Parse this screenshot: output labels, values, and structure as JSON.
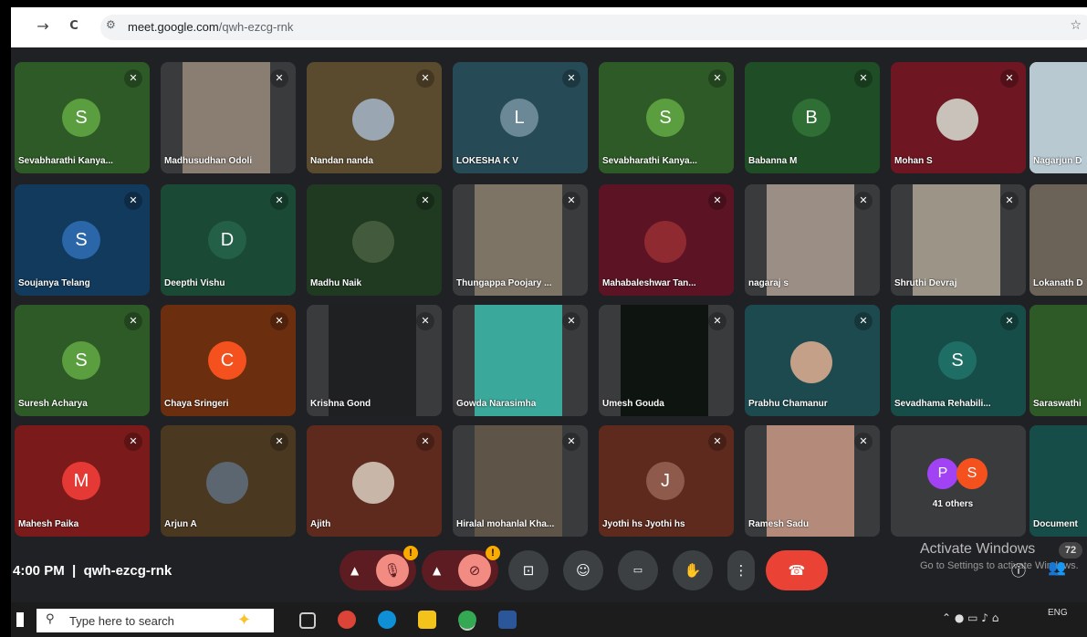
{
  "browser": {
    "back": "←",
    "forward": "→",
    "reload": "C",
    "url_domain": "meet.google.com",
    "url_path": "/qwh-ezcg-rnk"
  },
  "tiles": [
    {
      "name": "Sevabharathi Kanya...",
      "bg": "#2d5a27",
      "kind": "initial",
      "initial": "S",
      "acolor": "#5b9e3f"
    },
    {
      "name": "Madhusudhan Odoli",
      "bg": "#3a3b3d",
      "kind": "video",
      "vcolor": "#8a7d72"
    },
    {
      "name": "Nandan nanda",
      "bg": "#5a4a2e",
      "kind": "photo",
      "pcolor": "#9aa7b3"
    },
    {
      "name": "LOKESHA K V",
      "bg": "#274a57",
      "kind": "initial",
      "initial": "L",
      "acolor": "#6b8896"
    },
    {
      "name": "Sevabharathi Kanya...",
      "bg": "#2d5a27",
      "kind": "initial",
      "initial": "S",
      "acolor": "#5b9e3f"
    },
    {
      "name": "Babanna M",
      "bg": "#1f4d26",
      "kind": "initial",
      "initial": "B",
      "acolor": "#2f6e35"
    },
    {
      "name": "Mohan S",
      "bg": "#6e1622",
      "kind": "photo",
      "pcolor": "#c9c2bb"
    },
    {
      "name": "Nagarjun D",
      "bg": "#8aa6b8",
      "kind": "video",
      "vcolor": "#b8c9d2"
    },
    {
      "name": "Soujanya Telang",
      "bg": "#123a5c",
      "kind": "initial",
      "initial": "S",
      "acolor": "#2a66a8"
    },
    {
      "name": "Deepthi Vishu",
      "bg": "#1a4a36",
      "kind": "initial",
      "initial": "D",
      "acolor": "#236047"
    },
    {
      "name": "Madhu Naik",
      "bg": "#1f3a20",
      "kind": "photo",
      "pcolor": "#445a3c"
    },
    {
      "name": "Thungappa Poojary ...",
      "bg": "#3a3b3d",
      "kind": "video",
      "vcolor": "#7d7466"
    },
    {
      "name": "Mahabaleshwar Tan...",
      "bg": "#5c1424",
      "kind": "photo",
      "pcolor": "#8e2a30"
    },
    {
      "name": "nagaraj s",
      "bg": "#3a3b3d",
      "kind": "video",
      "vcolor": "#9b8e85"
    },
    {
      "name": "Shruthi Devraj",
      "bg": "#3a3b3d",
      "kind": "video",
      "vcolor": "#9b9487"
    },
    {
      "name": "Lokanath D",
      "bg": "#3a3b3d",
      "kind": "video",
      "vcolor": "#6b6358"
    },
    {
      "name": "Suresh Acharya",
      "bg": "#2d5a27",
      "kind": "initial",
      "initial": "S",
      "acolor": "#5b9e3f"
    },
    {
      "name": "Chaya Sringeri",
      "bg": "#6b2e0f",
      "kind": "initial",
      "initial": "C",
      "acolor": "#f4511e"
    },
    {
      "name": "Krishna Gond",
      "bg": "#3a3b3d",
      "kind": "video",
      "vcolor": "#1f2022"
    },
    {
      "name": "Gowda Narasimha",
      "bg": "#3a3b3d",
      "kind": "video",
      "vcolor": "#3aa89a"
    },
    {
      "name": "Umesh Gouda",
      "bg": "#3a3b3d",
      "kind": "video",
      "vcolor": "#0e1510"
    },
    {
      "name": "Prabhu Chamanur",
      "bg": "#1c4a4f",
      "kind": "photo",
      "pcolor": "#c4a088"
    },
    {
      "name": "Sevadhama Rehabili...",
      "bg": "#174d48",
      "kind": "initial",
      "initial": "S",
      "acolor": "#1e6e66"
    },
    {
      "name": "Saraswathi",
      "bg": "#2d5a27",
      "kind": "video",
      "vcolor": "#2d5a27"
    },
    {
      "name": "Mahesh Paika",
      "bg": "#7a1a1a",
      "kind": "initial",
      "initial": "M",
      "acolor": "#e53935"
    },
    {
      "name": "Arjun A",
      "bg": "#4a3820",
      "kind": "photo",
      "pcolor": "#5c6670"
    },
    {
      "name": "Ajith",
      "bg": "#5e2a1e",
      "kind": "photo",
      "pcolor": "#c8b7a8"
    },
    {
      "name": "Hiralal mohanlal Kha...",
      "bg": "#3a3b3d",
      "kind": "video",
      "vcolor": "#5e5548"
    },
    {
      "name": "Jyothi hs Jyothi hs",
      "bg": "#5e2a1e",
      "kind": "initial",
      "initial": "J",
      "acolor": "#8d5a4b"
    },
    {
      "name": "Ramesh Sadu",
      "bg": "#3a3b3d",
      "kind": "video",
      "vcolor": "#b48b7a"
    },
    {
      "name": "41 others",
      "bg": "#3a3b3d",
      "kind": "others"
    },
    {
      "name": "Document",
      "bg": "#174d48",
      "kind": "video",
      "vcolor": "#174d48"
    }
  ],
  "others": {
    "a": "P",
    "b": "S"
  },
  "meeting": {
    "time": "4:00 PM",
    "separator": "|",
    "code": "qwh-ezcg-rnk"
  },
  "controls": {
    "mic_badge": "!",
    "cam_badge": "!",
    "more": "⋮",
    "hangup": "☎"
  },
  "overlay": {
    "activate": "Activate Windows",
    "activate_sub": "Go to Settings to activate Windows.",
    "count": "72"
  },
  "taskbar": {
    "search_placeholder": "Type here to search",
    "lang": "ENG"
  },
  "colors": {
    "meet_bg": "#202124",
    "hangup": "#ea4335",
    "muted_ctrl": "#f28b82",
    "badge": "#f9ab00"
  }
}
